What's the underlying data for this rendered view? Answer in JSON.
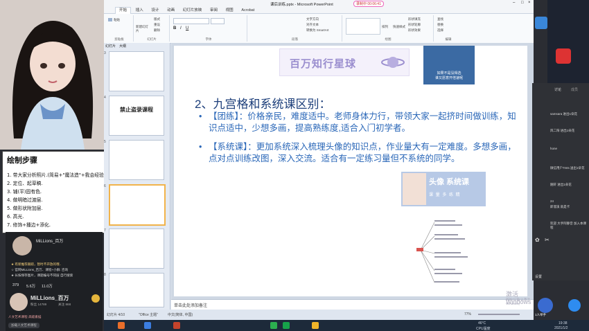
{
  "window": {
    "title": "课后训练.pptx - Microsoft PowerPoint",
    "rec_status": "录制中 00:06:41"
  },
  "ribbon": {
    "tabs": [
      "开始",
      "插入",
      "设计",
      "动画",
      "幻灯片放映",
      "审阅",
      "视图",
      "Acrobat"
    ],
    "groups": {
      "clipboard": "剪贴板",
      "slides": "幻灯片",
      "font": "字体",
      "paragraph": "段落",
      "drawing": "绘图",
      "editing": "编辑"
    },
    "buttons": {
      "paste": "粘贴",
      "new_slide": "新建幻灯片",
      "layout": "版式",
      "reset": "重设",
      "delete": "删除",
      "text_direction": "文字方向",
      "align_text": "对齐文本",
      "smartart": "转换为 SmartArt",
      "arrange": "排列",
      "quick_styles": "快速样式",
      "shape_fill": "形状填充",
      "shape_outline": "形状轮廓",
      "shape_effect": "形状效果",
      "find": "查找",
      "replace": "替换",
      "select": "选择"
    }
  },
  "panel_tabs": [
    "幻灯片",
    "大纲"
  ],
  "thumbnails": [
    {
      "num": "3"
    },
    {
      "num": "4",
      "title": "禁止盗录课程"
    },
    {
      "num": "5"
    },
    {
      "num": "6"
    },
    {
      "num": "7"
    },
    {
      "num": "8"
    },
    {
      "num": "9"
    }
  ],
  "slide": {
    "logo_text": "百万知行星球",
    "meme_caption": "如果不是没得选\n谁又愿意开倍速呢",
    "heading": "2、九宫格和系统课区别：",
    "bullets": [
      "【团练】：价格亲民，难度适中。老师身体力行，带领大家一起挤时间做训练，知识点适中，少想多画，提高熟练度,适合入门初学者。",
      "【系统课】：更加系统深入梳理头像的知识点，作业量大有一定难度。多想多画，点对点训练改图，深入交流。适合有一定练习量但不系统的同学。"
    ],
    "card_title": "头像 系统课",
    "card_sub": "课 量 多  练 精"
  },
  "notes_placeholder": "单击此处添加备注",
  "statusbar": {
    "slide_no": "幻灯片 4/10",
    "theme": "\"Office 主题\"",
    "lang": "中文(简体, 中国)",
    "zoom": "77%"
  },
  "watermark": {
    "line1": "激活 Windows",
    "line2": "转到\"设置\"以激活 Windows。"
  },
  "whiteboard": {
    "title": "绘制步骤",
    "lines": [
      "1. 带大家分析照片.(简易+\"魔法造\"+我会经验)",
      "2. 定位、起草稿.",
      "3. 铺(平)固有色.",
      "4. 做明暗过渡层.",
      "5. 做形状附加层.",
      "6. 高光.",
      "7. 修饰+播边+添化."
    ]
  },
  "stream": {
    "name": "MiLLions_百万",
    "id_line": "抖音号: 14789",
    "msg1": "★ 有新推荐跟踪，暂时不开放的哦..",
    "msg2": "☆ 官网MiLLions_百万、课程+小群: 咨询",
    "msg3": "★ 长按保存图片，课题编号不同层 自行搜索",
    "stats": [
      "379",
      "5.6万",
      "11.0万"
    ],
    "user2": "MiLLions_百万",
    "fans": "粉丝 14789",
    "likes": "关注 868",
    "link1": "人文艺术课程·高级素描",
    "link2": "加载人文艺术课程"
  },
  "chat": {
    "tab1": "讨论",
    "tab2": "成员",
    "msgs": [
      "samsara 进出1朵花",
      "风二阳 进出1朵花",
      "hone",
      "微信用户7mts 送出1朵花",
      "随轩 进出1朵花",
      "24",
      "即溜溪 就是卡",
      "欢迎 大手阿静音 加入本课程"
    ],
    "footer": "设置",
    "hands_up": "1人举手"
  },
  "taskbar": {
    "temp": "46°C",
    "cpu": "CPU温度",
    "time": "19:38",
    "date": "2021/1/2"
  }
}
